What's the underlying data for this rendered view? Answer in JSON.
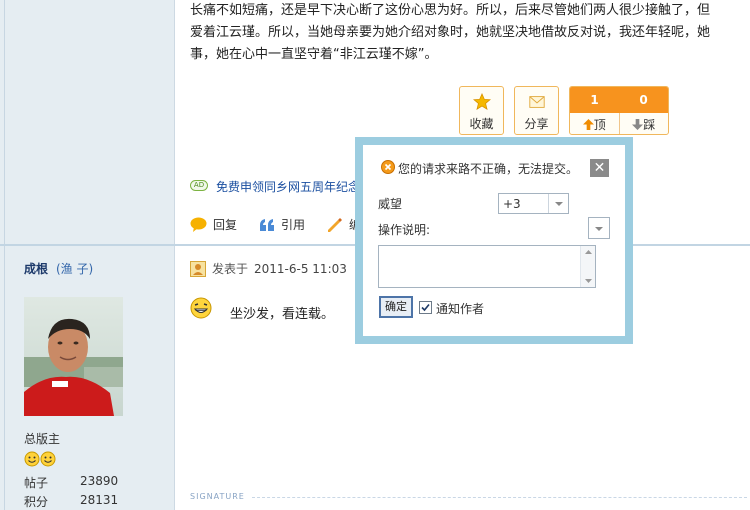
{
  "post": {
    "lines": [
      "长痛不如短痛，还是早下决心断了这份心思为好。所以，后来尽管她们两人很少接触了，但",
      "爱着江云瑾。所以，当她母亲要为她介绍对象时，她就坚决地借故反对说，我还年轻呢，她",
      "事，她在心中一直坚守着“非江云瑾不嫁”。"
    ],
    "actions": {
      "favorite": "收藏",
      "share": "分享",
      "up_count": "1",
      "down_count": "0",
      "up_label": "顶",
      "down_label": "踩"
    },
    "ad_badge": "AD",
    "ad_text": "免费申领同乡网五周年纪念",
    "reply": "回复",
    "quote": "引用",
    "edit": "编"
  },
  "dialog": {
    "message": "您的请求来路不正确，无法提交。",
    "close": "✕",
    "score_label": "威望",
    "score_value": "+3",
    "reason_label": "操作说明:",
    "confirm": "确定",
    "notify": "通知作者"
  },
  "reply_post": {
    "username": "成根",
    "user_title": "(渔 子)",
    "rank": "总版主",
    "stats": [
      {
        "label": "帖子",
        "value": "23890"
      },
      {
        "label": "积分",
        "value": "28131"
      }
    ],
    "posted_prefix": "发表于",
    "posted_time": "2011-6-5 11:03",
    "content": "坐沙发，看连载。",
    "signature": "SIGNATURE"
  },
  "colors": {
    "accent_orange": "#f7931e",
    "link_blue": "#1b4fa0",
    "dialog_frame": "#9ccde0",
    "sidebar_bg": "#e5edf2"
  }
}
